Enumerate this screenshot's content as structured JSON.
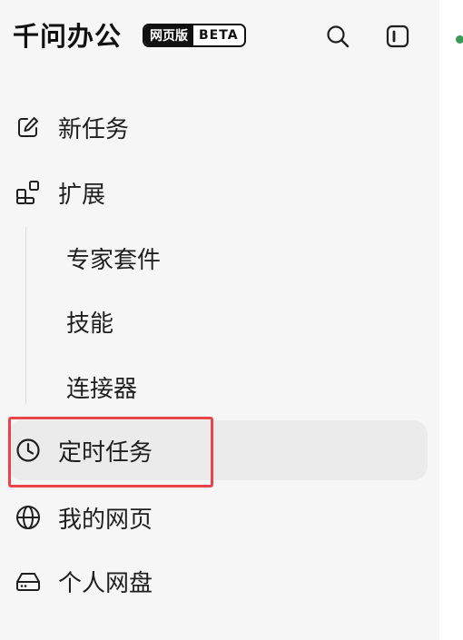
{
  "app": {
    "logo": "千问办公",
    "badge_web": "网页版",
    "badge_beta": "BETA"
  },
  "toolbar": {
    "search_icon": "search-icon",
    "sidebar_toggle_icon": "sidebar-toggle-icon"
  },
  "nav": {
    "new_task": "新任务",
    "extensions": "扩展",
    "sub_items": [
      "专家套件",
      "技能",
      "连接器"
    ],
    "scheduled_tasks": "定时任务",
    "my_pages": "我的网页",
    "personal_drive": "个人网盘"
  },
  "colors": {
    "highlight": "#e8454a",
    "selected_bg": "#ebebeb",
    "status_dot": "#3b9a57"
  }
}
